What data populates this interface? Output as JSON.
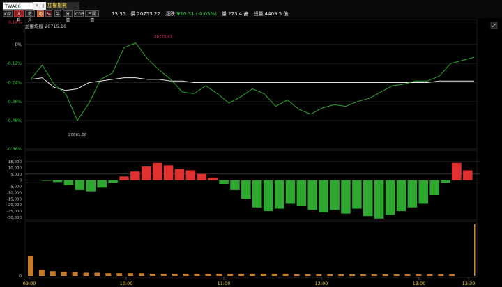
{
  "toolbar": {
    "symbol": "TWA00",
    "index_name": "加權指數",
    "buttons": [
      "K線",
      "大戶",
      "散戶",
      "均",
      "%",
      "半",
      "分價",
      "CDP",
      "三關價"
    ]
  },
  "quote": {
    "time": "13:35",
    "price_label": "價",
    "price": "20753.22",
    "change_label": "漲跌",
    "change": "▼10.31 (-0.05%)",
    "volume_label": "量",
    "volume": "223.4 億",
    "total_label": "總量",
    "total": "4409.5 億"
  },
  "price_panel": {
    "avg_label": "加權均線 20715.16",
    "high_annotation": "20775.63",
    "low_annotation": "20661.08",
    "y_labels": [
      "0.14%",
      "0%",
      "-0.12%",
      "-0.24%",
      "-0.36%",
      "-0.48%",
      "-0.66%"
    ]
  },
  "histogram_panel": {
    "y_labels": [
      "15,000",
      "10,000",
      "5,000",
      "0",
      "-5,000",
      "-10,000",
      "-15,000",
      "-20,000",
      "-25,000",
      "-30,000"
    ]
  },
  "volume_panel": {
    "y_labels": [
      "0"
    ]
  },
  "time_axis": {
    "labels": [
      "09:00",
      "10:00",
      "11:00",
      "12:00",
      "13:00",
      "13:30"
    ]
  },
  "colors": {
    "background": "#000000",
    "up": "#e03030",
    "down": "#2ea82e",
    "avg_line": "#e8e8e8",
    "axis_text_yellow": "#f5d442",
    "volume_bar": "#c77b2a",
    "last_volume": "#d4882c"
  },
  "icons": [
    "search-icon",
    "add-icon",
    "edit-icon"
  ],
  "chart_data": {
    "type": "line",
    "title": "加權指數",
    "x": [
      "09:00",
      "10:00",
      "11:00",
      "12:00",
      "13:00",
      "13:30"
    ],
    "price_pct": [
      -0.22,
      -0.13,
      -0.25,
      -0.31,
      -0.48,
      -0.37,
      -0.22,
      -0.18,
      -0.02,
      0.01,
      -0.09,
      -0.16,
      -0.22,
      -0.3,
      -0.31,
      -0.26,
      -0.31,
      -0.37,
      -0.33,
      -0.28,
      -0.31,
      -0.39,
      -0.35,
      -0.41,
      -0.44,
      -0.4,
      -0.38,
      -0.39,
      -0.36,
      -0.34,
      -0.3,
      -0.26,
      -0.25,
      -0.23,
      -0.23,
      -0.2,
      -0.12,
      -0.1,
      -0.08
    ],
    "avg_pct": [
      -0.22,
      -0.21,
      -0.27,
      -0.29,
      -0.28,
      -0.24,
      -0.23,
      -0.22,
      -0.21,
      -0.21,
      -0.22,
      -0.22,
      -0.23,
      -0.23,
      -0.24,
      -0.24,
      -0.24,
      -0.24,
      -0.24,
      -0.24,
      -0.24,
      -0.24,
      -0.24,
      -0.24,
      -0.24,
      -0.24,
      -0.24,
      -0.24,
      -0.24,
      -0.24,
      -0.24,
      -0.24,
      -0.24,
      -0.24,
      -0.24,
      -0.23,
      -0.23,
      -0.23,
      -0.23
    ],
    "histogram": [
      0,
      -500,
      -1500,
      -4000,
      -8000,
      -9000,
      -6000,
      -2000,
      3000,
      7000,
      11000,
      14000,
      12000,
      9000,
      8000,
      5000,
      2000,
      -3000,
      -8000,
      -15000,
      -22000,
      -25000,
      -23000,
      -19000,
      -21000,
      -24000,
      -26000,
      -24000,
      -27000,
      -23000,
      -29000,
      -31000,
      -28000,
      -25000,
      -22000,
      -19000,
      -12000,
      -2000,
      14000,
      8000
    ],
    "volume": [
      38,
      12,
      9,
      8,
      7,
      6,
      6,
      5,
      5,
      5,
      5,
      4,
      4,
      4,
      4,
      4,
      4,
      4,
      4,
      4,
      4,
      4,
      4,
      4,
      3,
      3,
      3,
      3,
      3,
      3,
      3,
      3,
      3,
      3,
      3,
      3,
      3,
      3,
      3,
      98
    ],
    "high": 20775.63,
    "low": 20661.08,
    "ylim_pct": [
      -0.66,
      0.14
    ],
    "ylim_hist": [
      -30000,
      15000
    ]
  }
}
